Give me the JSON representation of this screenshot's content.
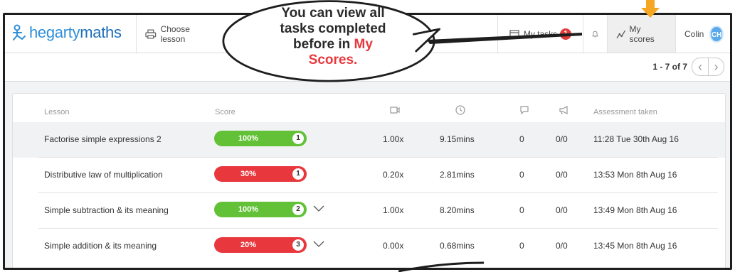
{
  "app": {
    "logo_text_a": "hegarty",
    "logo_text_b": "maths"
  },
  "nav": {
    "choose_lesson": "Choose lesson",
    "my_tasks": "My tasks",
    "my_tasks_count": "1",
    "my_scores": "My scores",
    "user_name": "Colin",
    "user_initials": "CH"
  },
  "pager": {
    "range": "1 - 7 of 7"
  },
  "callout": {
    "line1": "You can view all",
    "line2": "tasks completed",
    "line3": "before in ",
    "highlight": "My",
    "line4": "Scores."
  },
  "columns": {
    "lesson": "Lesson",
    "score": "Score",
    "video_icon": "video-icon",
    "clock_icon": "clock-icon",
    "comment_icon": "comment-icon",
    "megaphone_icon": "megaphone-icon",
    "assessment": "Assessment taken"
  },
  "colors": {
    "green": "#62c137",
    "red": "#e8383d",
    "accent": "#2f8fd8",
    "orange": "#f5a623"
  },
  "rows": [
    {
      "lesson": "Factorise simple expressions 2",
      "score": "100%",
      "attempts": "1",
      "status": "green",
      "speed": "1.00x",
      "time": "9.15mins",
      "comments": "0",
      "announce": "0/0",
      "taken": "11:28 Tue 30th Aug 16",
      "expandable": false,
      "score_fraction": 1.0
    },
    {
      "lesson": "Distributive law of multiplication",
      "score": "30%",
      "attempts": "1",
      "status": "red",
      "speed": "0.20x",
      "time": "2.81mins",
      "comments": "0",
      "announce": "0/0",
      "taken": "13:53 Mon 8th Aug 16",
      "expandable": false,
      "score_fraction": 0.3
    },
    {
      "lesson": "Simple subtraction & its meaning",
      "score": "100%",
      "attempts": "2",
      "status": "green",
      "speed": "1.00x",
      "time": "8.20mins",
      "comments": "0",
      "announce": "0/0",
      "taken": "13:49 Mon 8th Aug 16",
      "expandable": true,
      "score_fraction": 1.0
    },
    {
      "lesson": "Simple addition & its meaning",
      "score": "20%",
      "attempts": "3",
      "status": "red",
      "speed": "0.00x",
      "time": "0.68mins",
      "comments": "0",
      "announce": "0/0",
      "taken": "13:45 Mon 8th Aug 16",
      "expandable": true,
      "score_fraction": 0.2
    }
  ]
}
